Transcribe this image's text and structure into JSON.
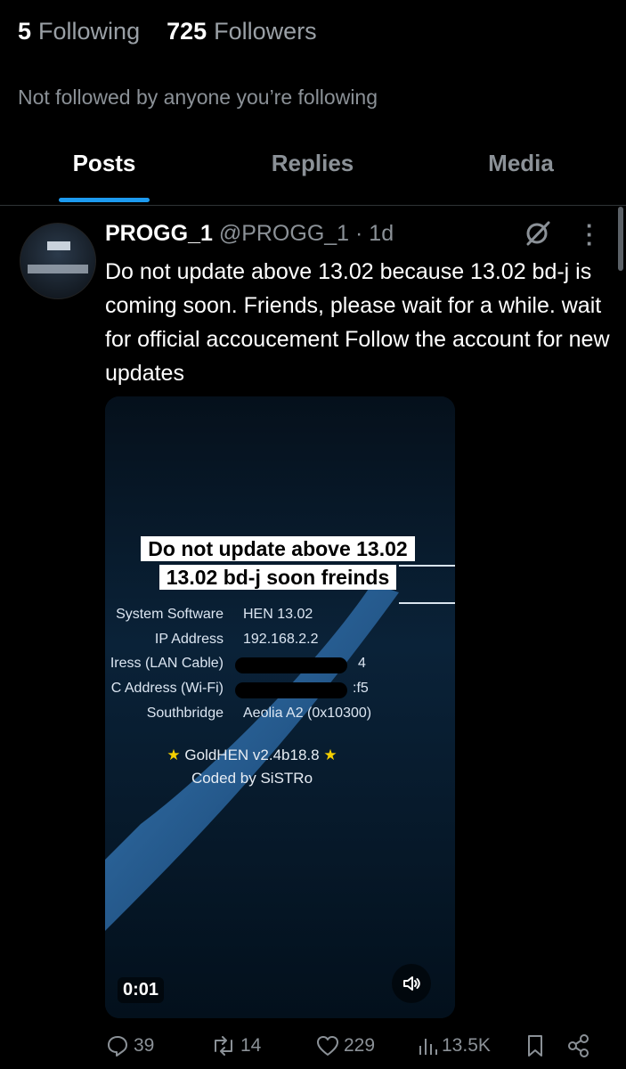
{
  "profile": {
    "following_count": "5",
    "following_label": "Following",
    "followers_count": "725",
    "followers_label": "Followers",
    "not_followed_text": "Not followed by anyone you’re following"
  },
  "tabs": [
    {
      "label": "Posts",
      "active": true
    },
    {
      "label": "Replies",
      "active": false
    },
    {
      "label": "Media",
      "active": false
    }
  ],
  "post": {
    "display_name": "PROGG_1",
    "handle_time": "@PROGG_1 · 1d",
    "text": "Do not update above 13.02 because 13.02 bd-j is coming soon. Friends, please wait for a while. wait for official accoucement Follow the account for new updates",
    "video": {
      "overlay_line1": "Do not update above 13.02",
      "overlay_line2": "13.02 bd-j soon freinds",
      "system_rows": [
        {
          "label": "System Software",
          "value": "HEN 13.02"
        },
        {
          "label": "IP Address",
          "value": "192.168.2.2"
        },
        {
          "label": "Iress (LAN Cable)",
          "value": "4"
        },
        {
          "label": "C Address (Wi-Fi)",
          "value": ":f5"
        },
        {
          "label": "Southbridge",
          "value": "Aeolia A2 (0x10300)"
        }
      ],
      "goldhen_line": "GoldHEN v2.4b18.8",
      "coded_by": "Coded by SiSTRo",
      "timestamp": "0:01"
    },
    "actions": {
      "replies": "39",
      "reposts": "14",
      "likes": "229",
      "views": "13.5K"
    }
  },
  "colors": {
    "accent": "#1d9bf0",
    "muted": "#8b9197",
    "background": "#000000",
    "gold_star": "#f5d000"
  }
}
